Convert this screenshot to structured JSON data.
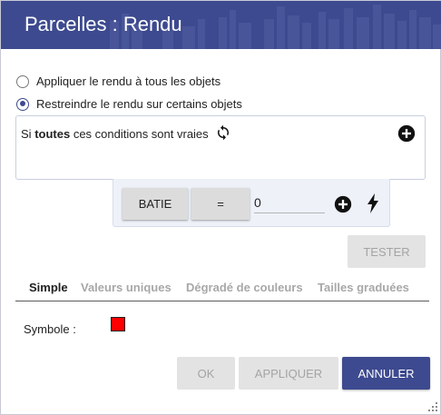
{
  "window": {
    "title": "Parcelles : Rendu"
  },
  "render_scope": {
    "options": [
      {
        "label": "Appliquer le rendu à tous les objets",
        "checked": false
      },
      {
        "label": "Restreindre le rendu sur certains objets",
        "checked": true
      }
    ]
  },
  "conditions": {
    "prefix": "Si",
    "quantifier": "toutes",
    "suffix": "ces conditions sont vraies",
    "row": {
      "field": "BATIE",
      "operator": "=",
      "value": "0"
    }
  },
  "buttons": {
    "test": "TESTER",
    "ok": "OK",
    "apply": "APPLIQUER",
    "cancel": "ANNULER"
  },
  "tabs": [
    {
      "label": "Simple",
      "active": true
    },
    {
      "label": "Valeurs uniques",
      "active": false
    },
    {
      "label": "Dégradé de couleurs",
      "active": false
    },
    {
      "label": "Tailles graduées",
      "active": false
    }
  ],
  "symbol": {
    "label": "Symbole :",
    "color": "#ff0000"
  },
  "colors": {
    "accent": "#3d4a8f",
    "disabled_bg": "#e3e3e3",
    "disabled_text": "#a4a4a4"
  },
  "icons": [
    "refresh-icon",
    "add-circle-icon",
    "lightning-bolt-icon",
    "resize-grip-icon"
  ]
}
